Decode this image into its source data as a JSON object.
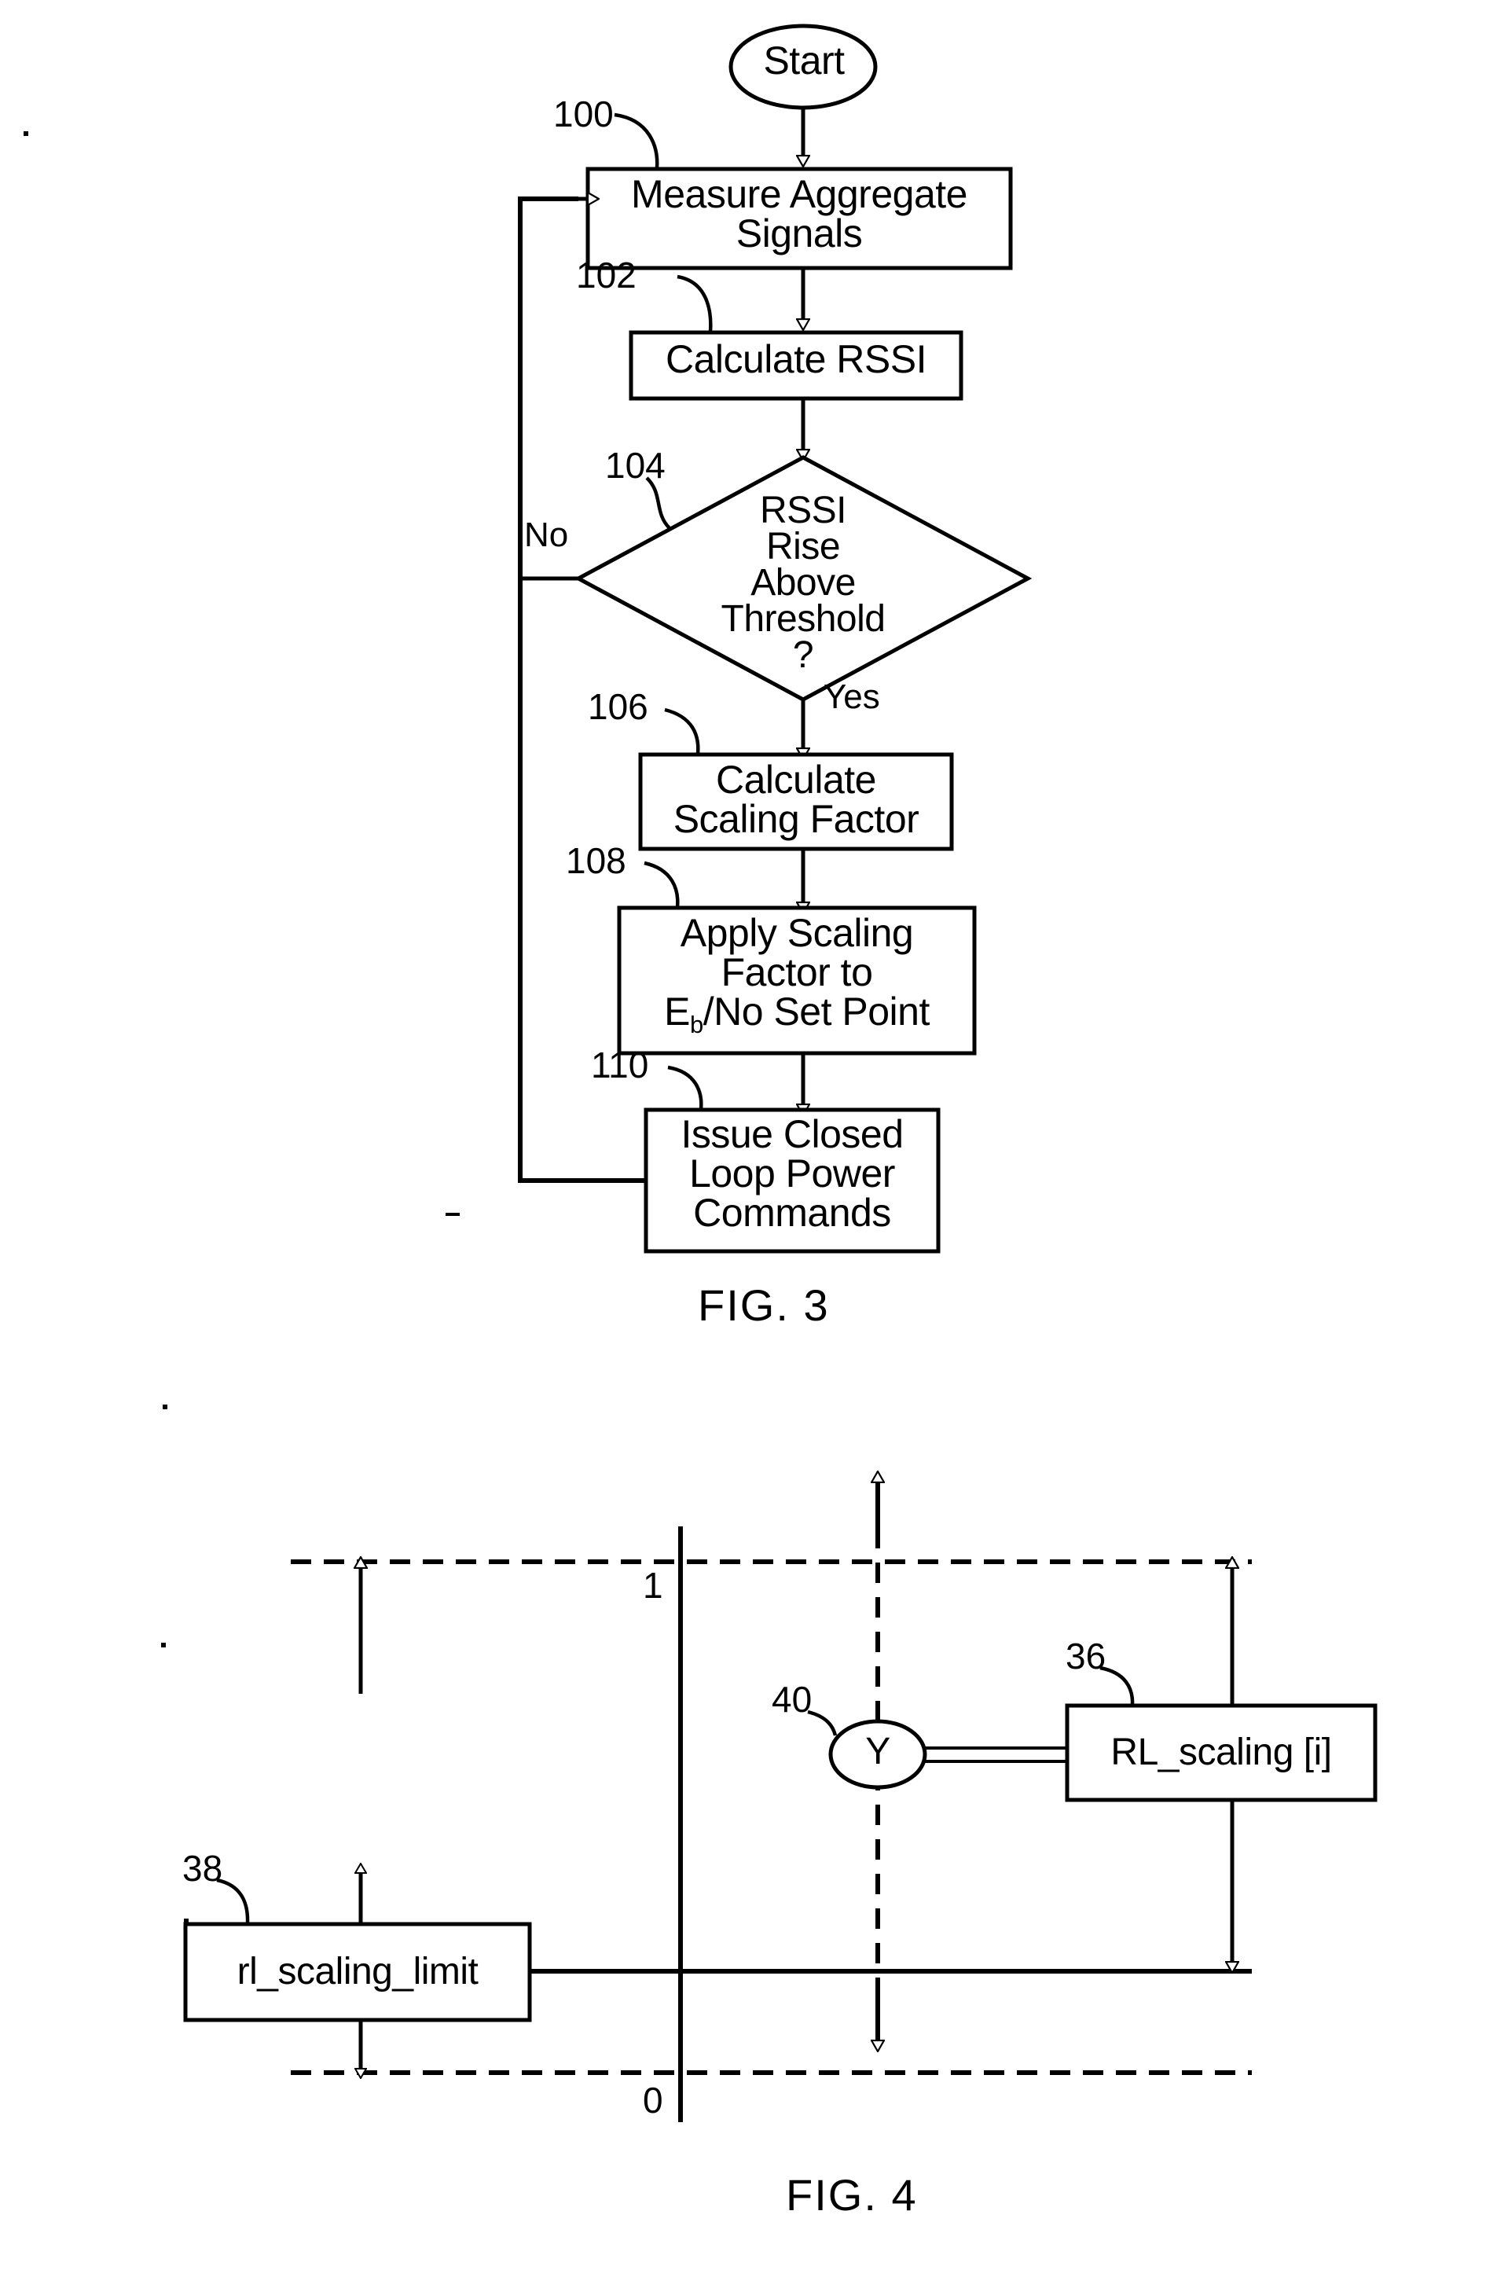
{
  "figures": [
    {
      "id": "fig3",
      "caption": "FIG. 3",
      "type": "flowchart",
      "terminator": {
        "label": "Start"
      },
      "edge_labels": {
        "no": "No",
        "yes": "Yes"
      },
      "nodes": [
        {
          "ref": "100",
          "shape": "process",
          "text_lines": [
            "Measure Aggregate",
            "Signals"
          ]
        },
        {
          "ref": "102",
          "shape": "process",
          "text_lines": [
            "Calculate RSSI"
          ]
        },
        {
          "ref": "104",
          "shape": "decision",
          "text_lines": [
            "RSSI",
            "Rise",
            "Above",
            "Threshold",
            "?"
          ]
        },
        {
          "ref": "106",
          "shape": "process",
          "text_lines": [
            "Calculate",
            "Scaling Factor"
          ]
        },
        {
          "ref": "108",
          "shape": "process",
          "text_lines": [
            "Apply Scaling",
            "Factor to",
            "E_b/No Set Point"
          ]
        },
        {
          "ref": "110",
          "shape": "process",
          "text_lines": [
            "Issue Closed",
            "Loop Power",
            "Commands"
          ]
        }
      ]
    },
    {
      "id": "fig4",
      "caption": "FIG. 4",
      "type": "range-diagram",
      "axis_labels": {
        "top": "1",
        "bottom": "0"
      },
      "nodes": [
        {
          "ref": "40",
          "shape": "ellipse",
          "text": "Y"
        },
        {
          "ref": "36",
          "shape": "box",
          "text": "RL_scaling [i]"
        },
        {
          "ref": "38",
          "shape": "box",
          "text": "rl_scaling_limit"
        }
      ]
    }
  ]
}
